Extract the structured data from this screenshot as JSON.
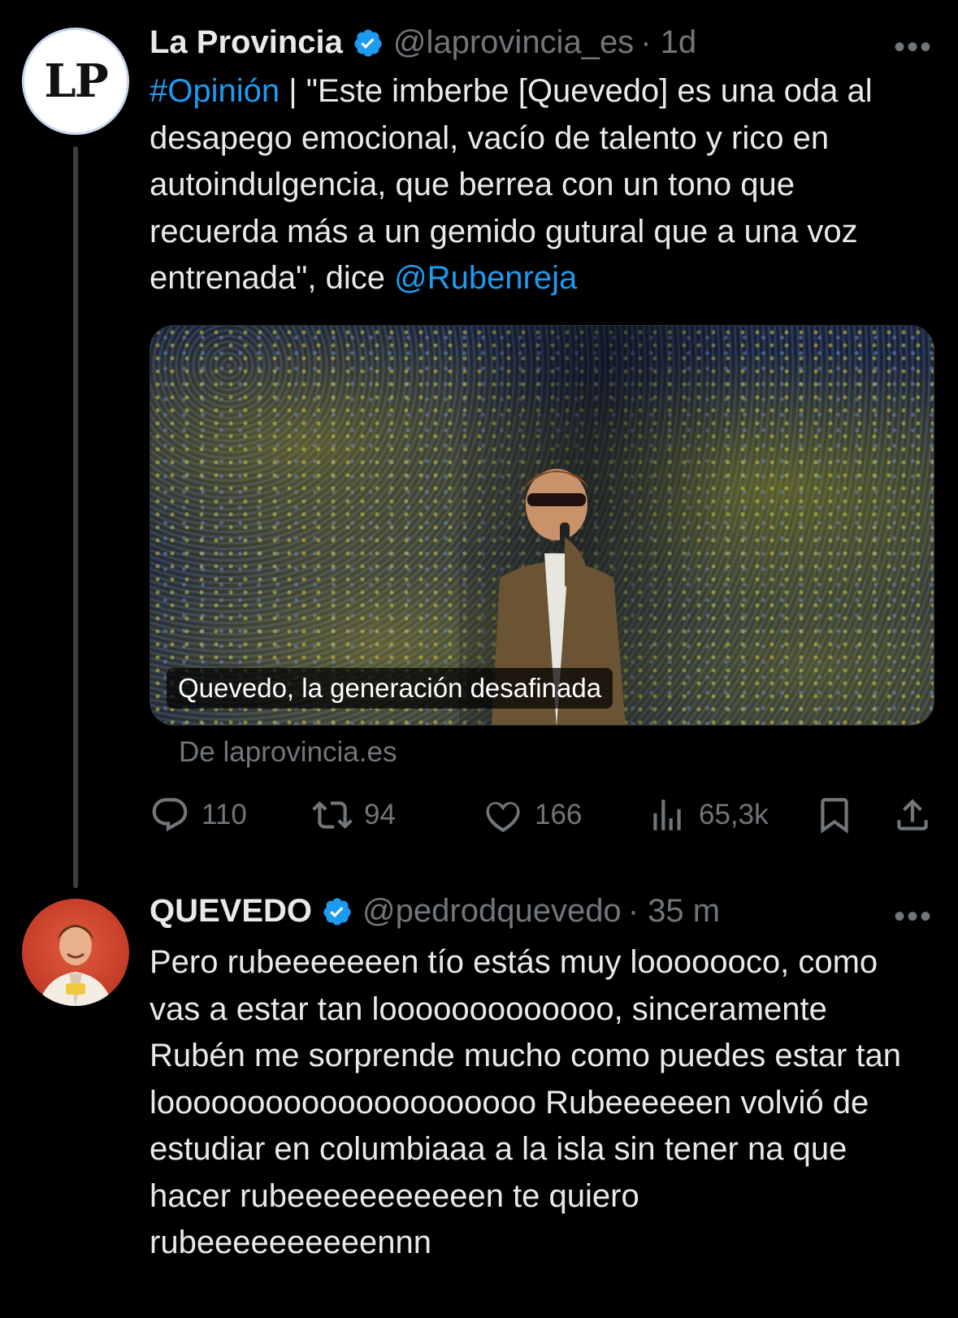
{
  "tweets": [
    {
      "author_name": "La Provincia",
      "avatar_text": "LP",
      "handle": "@laprovincia_es",
      "time": "· 1d",
      "more_label": "•••",
      "text_parts": {
        "hashtag": "#Opinión",
        "body": " | \"Este imberbe [Quevedo] es una oda al desapego emocional, vacío de talento y rico en autoindulgencia, que berrea con un tono que recuerda más a un gemido gutural que a una voz entrenada\", dice ",
        "mention": "@Rubenreja"
      },
      "card": {
        "caption": "Quevedo, la generación desafinada",
        "source": "De laprovincia.es"
      },
      "actions": {
        "replies": "110",
        "retweets": "94",
        "likes": "166",
        "views": "65,3k"
      }
    },
    {
      "author_name": "QUEVEDO",
      "handle": "@pedrodquevedo",
      "time": "· 35 m",
      "more_label": "•••",
      "text": "Pero rubeeeeeeen tío estás muy looooooco, como vas a estar tan looooooooooooo, sinceramente Rubén me sorprende mucho como puedes estar tan looooooooooooooooooooo Rubeeeeeen volvió de estudiar en columbiaaa a la isla sin tener na que hacer rubeeeeeeeeeeen te quiero rubeeeeeeeeeennn"
    }
  ],
  "colors": {
    "background": "#000000",
    "text": "#e7e9ea",
    "muted": "#71767b",
    "link": "#1d9bf0",
    "verified": "#1d9bf0"
  },
  "icons": [
    "verified-badge-icon",
    "reply-icon",
    "retweet-icon",
    "like-icon",
    "views-icon",
    "bookmark-icon",
    "share-icon",
    "more-icon"
  ]
}
